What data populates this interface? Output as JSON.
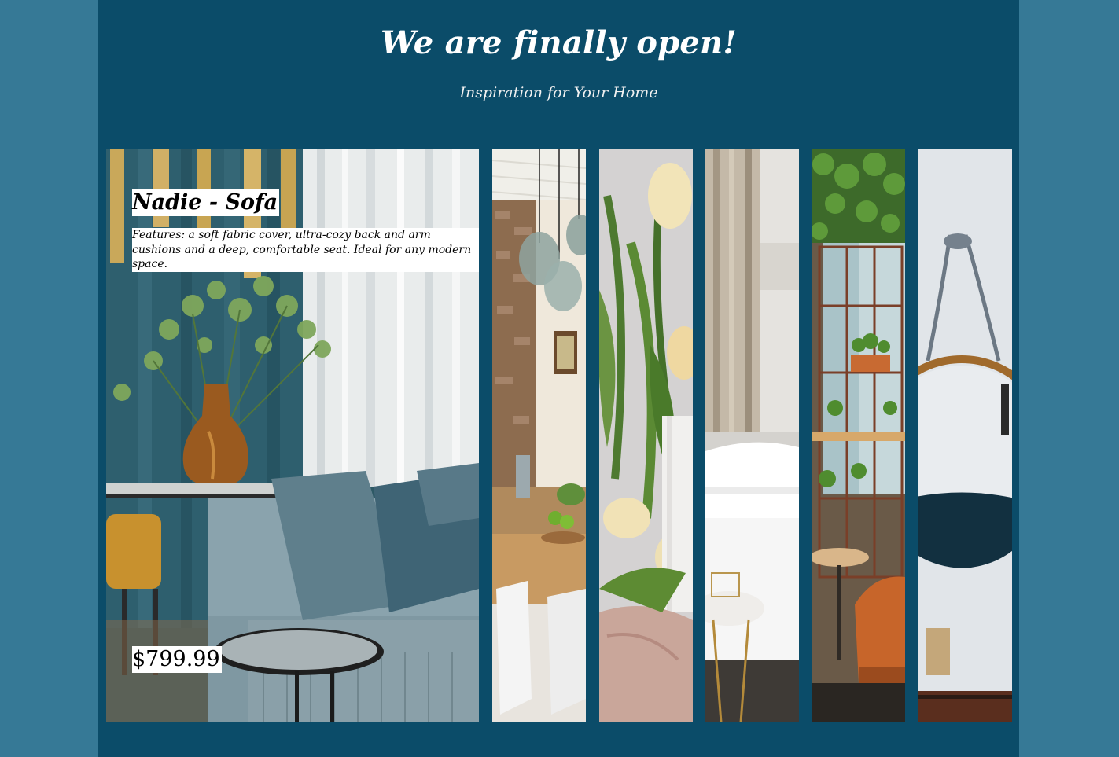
{
  "hero": {
    "title": "We are finally open!",
    "subtitle": "Inspiration for Your Home"
  },
  "featured_product": {
    "name": "Nadie - Sofa",
    "description": "Features: a soft fabric cover, ultra-cozy back and arm cushions and a deep, comfortable seat. Ideal for any modern space.",
    "price": "$799.99"
  },
  "gallery": {
    "panels": [
      {
        "image": "living-room-sofa-photo"
      },
      {
        "image": "dining-kitchen-photo"
      },
      {
        "image": "tulips-vase-photo"
      },
      {
        "image": "bathtub-photo"
      },
      {
        "image": "plant-shelf-cafe-photo"
      },
      {
        "image": "round-mirror-photo"
      }
    ]
  },
  "colors": {
    "outer_background": "#367996",
    "page_background": "#0b4c69",
    "text": "#ffffff",
    "label_background": "#ffffff",
    "label_text": "#000000"
  }
}
